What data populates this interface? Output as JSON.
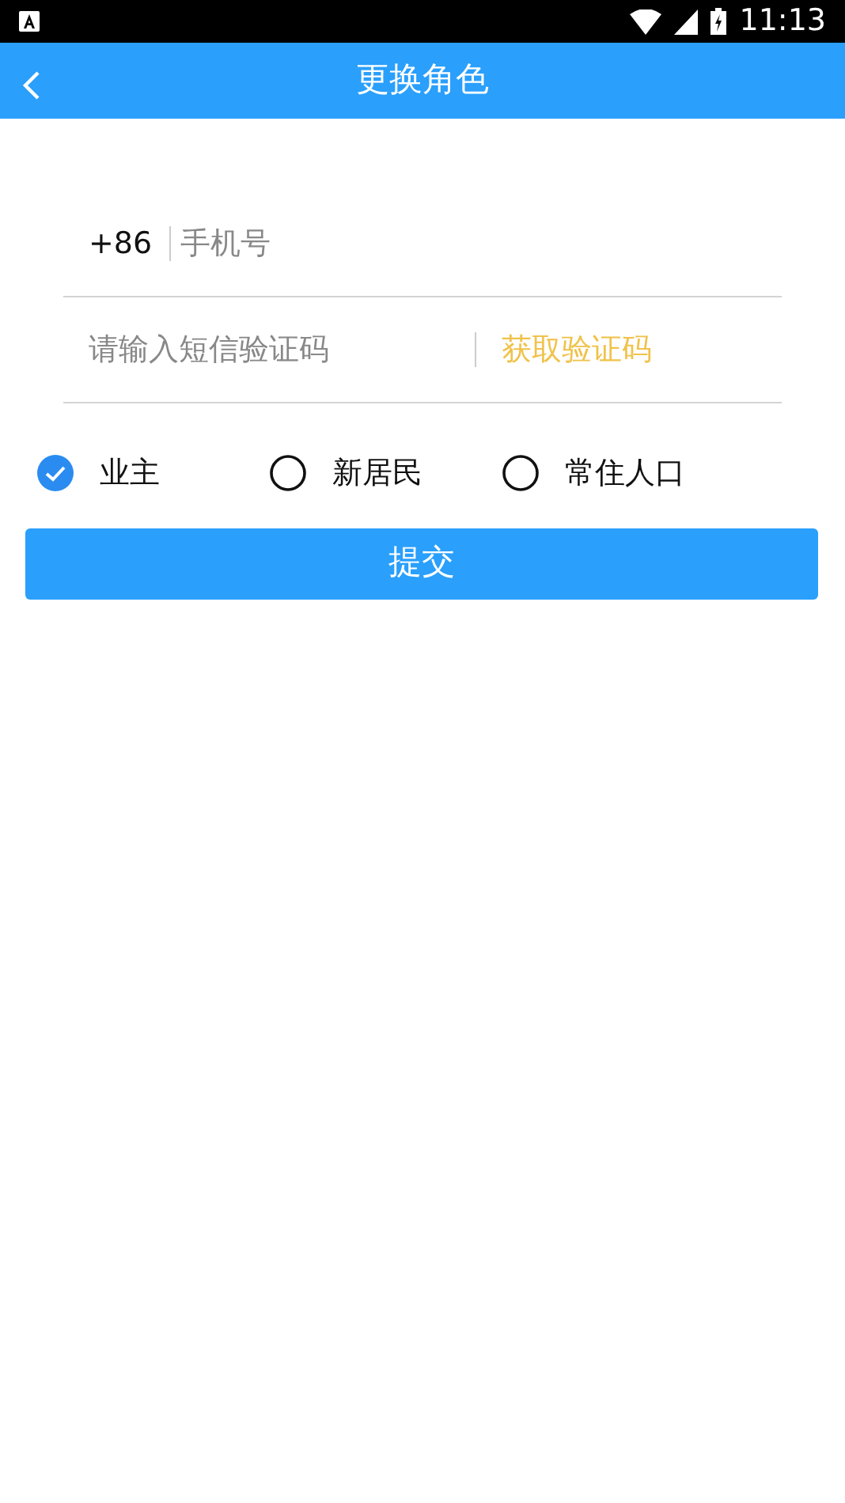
{
  "status_bar": {
    "time": "11:13"
  },
  "app_bar": {
    "title": "更换角色"
  },
  "phone": {
    "country_code": "+86",
    "placeholder": "手机号"
  },
  "sms_code": {
    "placeholder": "请输入短信验证码",
    "get_code_button": "获取验证码"
  },
  "roles": [
    {
      "label": "业主",
      "selected": true
    },
    {
      "label": "新居民",
      "selected": false
    },
    {
      "label": "常住人口",
      "selected": false
    }
  ],
  "submit_button": "提交"
}
